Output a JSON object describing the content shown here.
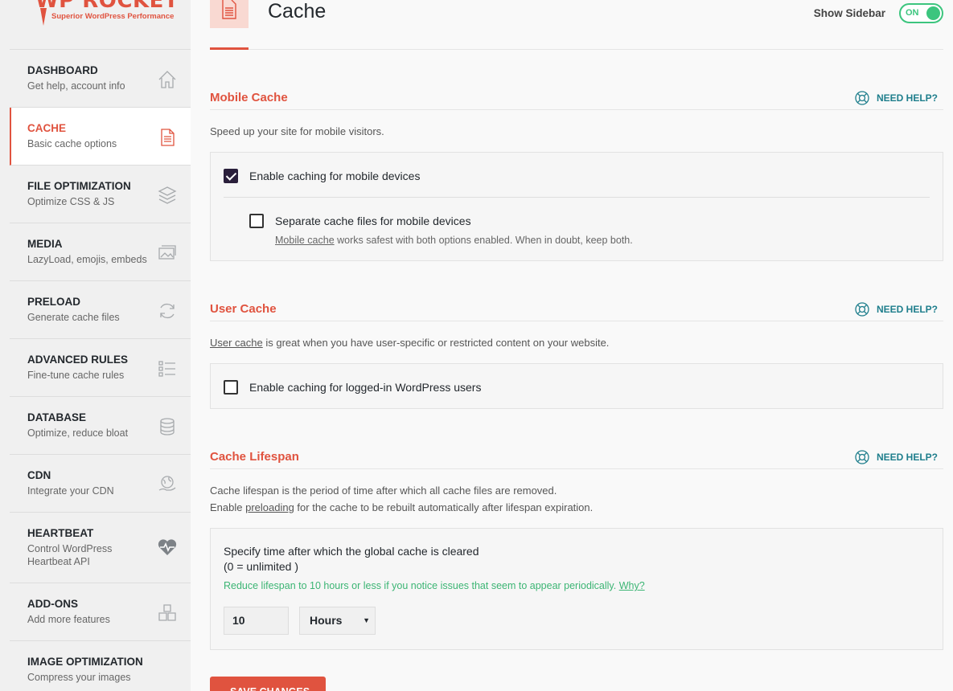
{
  "brand": {
    "name": "WP ROCKET",
    "tagline": "Superior WordPress Performance"
  },
  "nav": [
    {
      "title": "DASHBOARD",
      "desc": "Get help, account info",
      "icon": "home-icon"
    },
    {
      "title": "CACHE",
      "desc": "Basic cache options",
      "icon": "document-icon",
      "active": true
    },
    {
      "title": "FILE OPTIMIZATION",
      "desc": "Optimize CSS & JS",
      "icon": "layers-icon"
    },
    {
      "title": "MEDIA",
      "desc": "LazyLoad, emojis, embeds",
      "icon": "images-icon"
    },
    {
      "title": "PRELOAD",
      "desc": "Generate cache files",
      "icon": "refresh-icon"
    },
    {
      "title": "ADVANCED RULES",
      "desc": "Fine-tune cache rules",
      "icon": "checklist-icon"
    },
    {
      "title": "DATABASE",
      "desc": "Optimize, reduce bloat",
      "icon": "database-icon"
    },
    {
      "title": "CDN",
      "desc": "Integrate your CDN",
      "icon": "globe-hand-icon"
    },
    {
      "title": "HEARTBEAT",
      "desc": "Control WordPress Heartbeat API",
      "icon": "heartbeat-icon"
    },
    {
      "title": "ADD-ONS",
      "desc": "Add more features",
      "icon": "cubes-icon"
    },
    {
      "title": "IMAGE OPTIMIZATION",
      "desc": "Compress your images",
      "icon": "image-icon"
    }
  ],
  "header": {
    "title": "Cache",
    "show_sidebar": "Show Sidebar",
    "toggle": "ON"
  },
  "need_help": "NEED HELP?",
  "mobile": {
    "title": "Mobile Cache",
    "sub": "Speed up your site for mobile visitors.",
    "opt1": "Enable caching for mobile devices",
    "opt1_checked": true,
    "opt2": "Separate cache files for mobile devices",
    "opt2_checked": false,
    "note_link": "Mobile cache",
    "note_rest": " works safest with both options enabled. When in doubt, keep both."
  },
  "user": {
    "title": "User Cache",
    "sub_link": "User cache",
    "sub_rest": " is great when you have user-specific or restricted content on your website.",
    "opt1": "Enable caching for logged-in WordPress users",
    "opt1_checked": false
  },
  "lifespan": {
    "title": "Cache Lifespan",
    "sub1": "Cache lifespan is the period of time after which all cache files are removed.",
    "sub2_pre": "Enable ",
    "sub2_link": "preloading",
    "sub2_rest": " for the cache to be rebuilt automatically after lifespan expiration.",
    "spec1": "Specify time after which the global cache is cleared",
    "spec2": "(0 = unlimited )",
    "hint": "Reduce lifespan to 10 hours or less if you notice issues that seem to appear periodically. ",
    "hint_link": "Why?",
    "value": "10",
    "unit": "Hours"
  },
  "save_label": "SAVE CHANGES",
  "colors": {
    "accent": "#e0533f",
    "toggle": "#3cc57e",
    "help": "#1e7e8c",
    "hint": "#3cb574"
  }
}
